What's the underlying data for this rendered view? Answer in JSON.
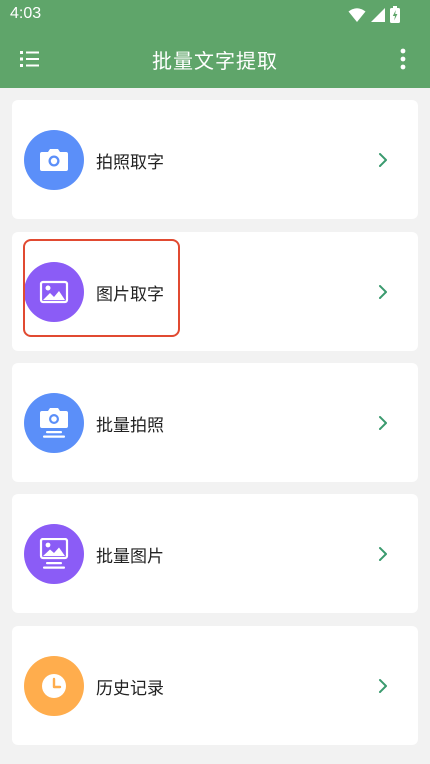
{
  "status_bar": {
    "time": "4:03",
    "icons": [
      "wifi-icon",
      "signal-icon",
      "battery-charging-icon"
    ]
  },
  "app_bar": {
    "title": "批量文字提取",
    "left_icon": "list-menu-icon",
    "right_icon": "more-vert-icon",
    "color": "#5fa56a"
  },
  "menu_items": [
    {
      "label": "拍照取字",
      "icon": "camera-icon",
      "color": "#5b8ff9"
    },
    {
      "label": "图片取字",
      "icon": "image-icon",
      "color": "#8b5cf6"
    },
    {
      "label": "批量拍照",
      "icon": "batch-camera-icon",
      "color": "#5b8ff9"
    },
    {
      "label": "批量图片",
      "icon": "batch-image-icon",
      "color": "#8b5cf6"
    },
    {
      "label": "历史记录",
      "icon": "clock-icon",
      "color": "#ffad4d"
    }
  ],
  "highlight_color": "#e14a31",
  "chevron_color": "#3a9a6e"
}
